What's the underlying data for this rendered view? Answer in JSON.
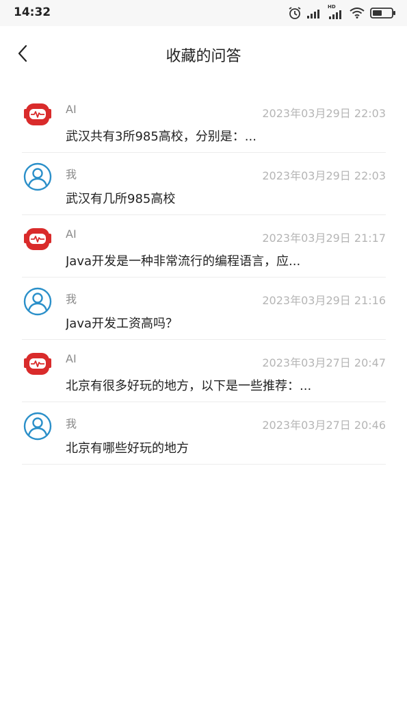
{
  "status_bar": {
    "time": "14:32",
    "icons": [
      "alarm-icon",
      "signal-icon",
      "hd-signal-icon",
      "wifi-icon",
      "battery-icon"
    ],
    "hd_label": "HD"
  },
  "header": {
    "back_icon": "chevron-left-icon",
    "title": "收藏的问答"
  },
  "colors": {
    "ai_avatar": "#d92b2b",
    "user_avatar": "#2a8fc9",
    "timestamp": "#b5b5b5",
    "sender": "#8a8a8a"
  },
  "items": [
    {
      "type": "ai",
      "sender": "AI",
      "time": "2023年03月29日 22:03",
      "text": "武汉共有3所985高校，分别是：..."
    },
    {
      "type": "user",
      "sender": "我",
      "time": "2023年03月29日 22:03",
      "text": "武汉有几所985高校"
    },
    {
      "type": "ai",
      "sender": "AI",
      "time": "2023年03月29日 21:17",
      "text": "Java开发是一种非常流行的编程语言，应..."
    },
    {
      "type": "user",
      "sender": "我",
      "time": "2023年03月29日 21:16",
      "text": "Java开发工资高吗？"
    },
    {
      "type": "ai",
      "sender": "AI",
      "time": "2023年03月27日 20:47",
      "text": "北京有很多好玩的地方，以下是一些推荐：..."
    },
    {
      "type": "user",
      "sender": "我",
      "time": "2023年03月27日 20:46",
      "text": "北京有哪些好玩的地方"
    }
  ]
}
